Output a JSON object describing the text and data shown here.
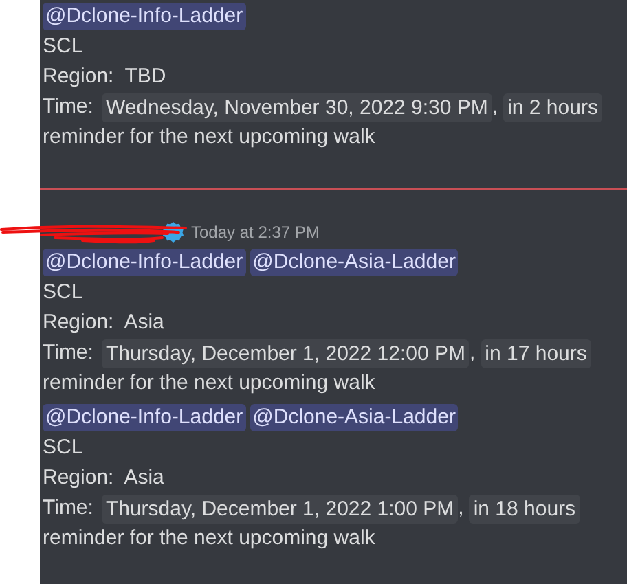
{
  "messages": [
    {
      "divider_before": false,
      "mentions": [
        "@Dclone-Info-Ladder"
      ],
      "title": "SCL",
      "region": "Region:  TBD",
      "time_label": "Time:",
      "time": "Wednesday, November 30, 2022 9:30 PM",
      "separator": ",",
      "relative": "in 2 hours",
      "note": "reminder for the next upcoming walk"
    },
    {
      "divider_before": true,
      "header": {
        "name_redacted": true,
        "timestamp": "Today at 2:37 PM"
      },
      "mentions": [
        "@Dclone-Info-Ladder",
        "@Dclone-Asia-Ladder"
      ],
      "title": "SCL",
      "region": "Region:  Asia",
      "time_label": "Time:",
      "time": "Thursday, December 1, 2022 12:00 PM",
      "separator": ",",
      "relative": "in 17 hours",
      "note": "reminder for the next upcoming walk"
    },
    {
      "divider_before": false,
      "mentions": [
        "@Dclone-Info-Ladder",
        "@Dclone-Asia-Ladder"
      ],
      "title": "SCL",
      "region": "Region:  Asia",
      "time_label": "Time:",
      "time": "Thursday, December 1, 2022 1:00 PM",
      "separator": ",",
      "relative": "in 18 hours",
      "note": "reminder for the next upcoming walk"
    }
  ]
}
